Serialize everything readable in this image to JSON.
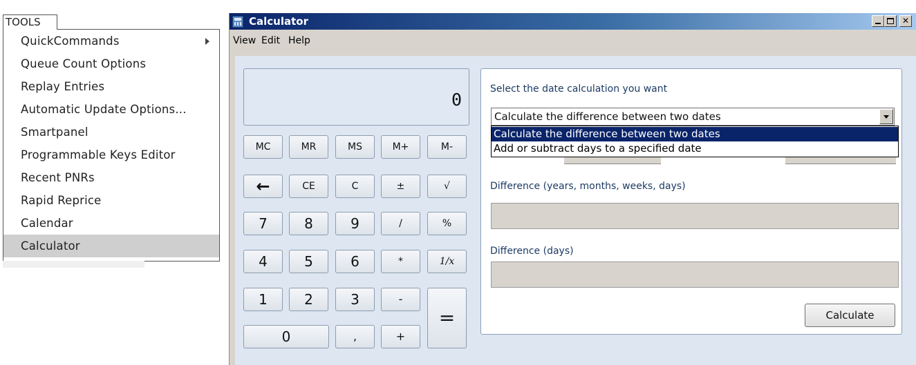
{
  "tools_menu": {
    "header": "TOOLS",
    "items": [
      {
        "label": "QuickCommands",
        "has_submenu": true
      },
      {
        "label": "Queue Count Options"
      },
      {
        "label": "Replay Entries"
      },
      {
        "label": "Automatic Update Options..."
      },
      {
        "label": "Smartpanel"
      },
      {
        "label": "Programmable Keys Editor"
      },
      {
        "label": "Recent PNRs"
      },
      {
        "label": "Rapid Reprice"
      },
      {
        "label": "Calendar"
      },
      {
        "label": "Calculator",
        "selected": true
      }
    ]
  },
  "calculator": {
    "title": "Calculator",
    "menu": [
      "View",
      "Edit",
      "Help"
    ],
    "display": "0",
    "keys": {
      "mc": "MC",
      "mr": "MR",
      "ms": "MS",
      "mplus": "M+",
      "mminus": "M-",
      "back": "←",
      "ce": "CE",
      "c": "C",
      "plusminus": "±",
      "sqrt": "√",
      "k7": "7",
      "k8": "8",
      "k9": "9",
      "div": "/",
      "pct": "%",
      "k4": "4",
      "k5": "5",
      "k6": "6",
      "mul": "*",
      "recip": "1/x",
      "k1": "1",
      "k2": "2",
      "k3": "3",
      "sub": "-",
      "k0": "0",
      "dec": ",",
      "add": "+",
      "eq": "="
    },
    "date_panel": {
      "select_label": "Select the date calculation you want",
      "selected_mode": "Calculate the difference between two dates",
      "options": [
        "Calculate the difference between two dates",
        "Add or subtract days to a specified date"
      ],
      "difference_label": "Difference (years, months, weeks, days)",
      "difference_days_label": "Difference (days)",
      "calculate_button": "Calculate"
    }
  }
}
